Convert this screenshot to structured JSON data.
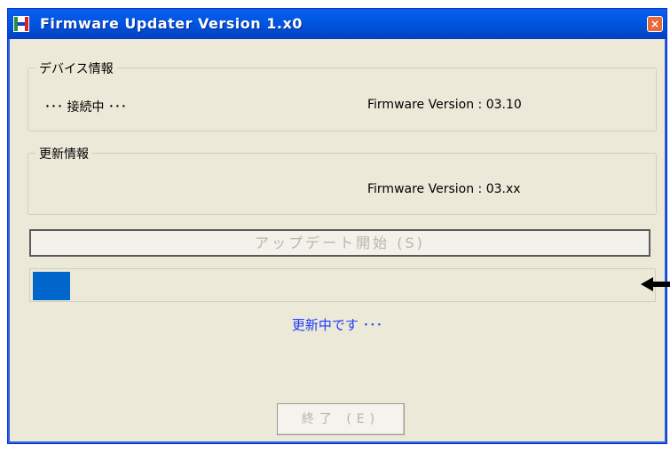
{
  "window": {
    "title": "Firmware Updater Version 1.x0",
    "close_glyph": "×"
  },
  "device_info": {
    "legend": "デバイス情報",
    "status": "･･･  接続中  ･･･",
    "version_label": "Firmware Version : 03.10"
  },
  "update_info": {
    "legend": "更新情報",
    "version_label": "Firmware Version : 03.xx"
  },
  "update_button": {
    "label": "アップデート開始 (S)",
    "enabled": false
  },
  "progress": {
    "value": 0.06,
    "fill_color": "#0066cc"
  },
  "status_text": "更新中です ･･･",
  "exit_button": {
    "label": "終了 (E)",
    "enabled": false
  },
  "icons": {
    "app": "firmware-app-icon",
    "close": "close-icon",
    "annotation": "arrow-left-icon"
  },
  "colors": {
    "titlebar": "#0057e6",
    "status_text": "#1f3cff",
    "window_bg": "#ece9d8"
  }
}
